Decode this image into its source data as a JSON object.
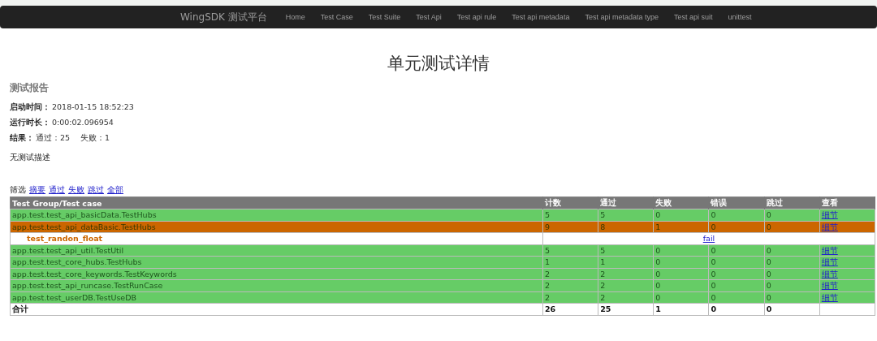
{
  "navbar": {
    "brand": "WingSDK 测试平台",
    "links": [
      "Home",
      "Test Case",
      "Test Suite",
      "Test Api",
      "Test api rule",
      "Test api metadata",
      "Test api metadata type",
      "Test api suit",
      "unittest"
    ]
  },
  "page_title": "单元测试详情",
  "report": {
    "heading": "测试报告",
    "fields": [
      {
        "label": "启动时间：",
        "value": "2018-01-15 18:52:23"
      },
      {
        "label": "运行时长：",
        "value": "0:00:02.096954"
      },
      {
        "label": "结果：",
        "value": "通过：25　 失败：1"
      }
    ],
    "description": "无测试描述"
  },
  "filter": {
    "label": "筛选",
    "links": [
      "摘要",
      "通过",
      "失败",
      "跳过",
      "全部"
    ]
  },
  "table": {
    "columns": [
      "Test Group/Test case",
      "计数",
      "通过",
      "失败",
      "错误",
      "跳过",
      "查看"
    ],
    "rows": [
      {
        "kind": "group",
        "color": "#66cc66",
        "name": "app.test.test_api_basicData.TestHubs",
        "cells": [
          "5",
          "5",
          "0",
          "0",
          "0"
        ],
        "link": "细节"
      },
      {
        "kind": "group",
        "color": "#cc6600",
        "name": "app.test.test_api_dataBasic.TestHubs",
        "cells": [
          "9",
          "8",
          "1",
          "0",
          "0"
        ],
        "link": "细节"
      },
      {
        "kind": "case",
        "name": "test_randon_float",
        "link": "fail"
      },
      {
        "kind": "group",
        "color": "#66cc66",
        "name": "app.test.test_api_util.TestUtil",
        "cells": [
          "5",
          "5",
          "0",
          "0",
          "0"
        ],
        "link": "细节"
      },
      {
        "kind": "group",
        "color": "#66cc66",
        "name": "app.test.test_core_hubs.TestHubs",
        "cells": [
          "1",
          "1",
          "0",
          "0",
          "0"
        ],
        "link": "细节"
      },
      {
        "kind": "group",
        "color": "#66cc66",
        "name": "app.test.test_core_keywords.TestKeywords",
        "cells": [
          "2",
          "2",
          "0",
          "0",
          "0"
        ],
        "link": "细节"
      },
      {
        "kind": "group",
        "color": "#66cc66",
        "name": "app.test.test_api_runcase.TestRunCase",
        "cells": [
          "2",
          "2",
          "0",
          "0",
          "0"
        ],
        "link": "细节"
      },
      {
        "kind": "group",
        "color": "#66cc66",
        "name": "app.test.test_userDB.TestUseDB",
        "cells": [
          "2",
          "2",
          "0",
          "0",
          "0"
        ],
        "link": "细节"
      }
    ],
    "total": {
      "label": "合计",
      "cells": [
        "26",
        "25",
        "1",
        "0",
        "0"
      ]
    }
  }
}
